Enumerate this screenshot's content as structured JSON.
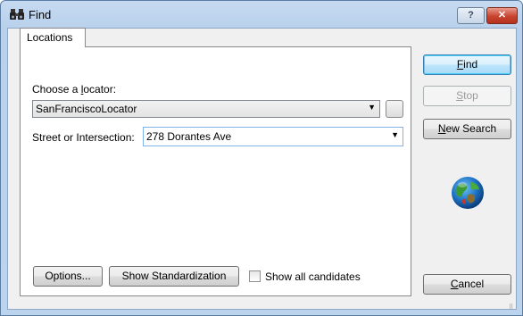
{
  "window": {
    "title": "Find",
    "help_glyph": "?",
    "close_glyph": "✕"
  },
  "tabs": [
    {
      "label": "Locations",
      "selected": true
    }
  ],
  "locator": {
    "label_pre": "Choose a ",
    "label_accel": "l",
    "label_post": "ocator:",
    "selected_value": "SanFranciscoLocator"
  },
  "street": {
    "label": "Street or Intersection:",
    "value": "278 Dorantes Ave"
  },
  "bottom": {
    "options_label": "Options...",
    "standardization_label": "Show Standardization",
    "show_all_label": "Show all candidates",
    "show_all_checked": false
  },
  "side_buttons": {
    "find_accel": "F",
    "find_rest": "ind",
    "stop_accel": "S",
    "stop_rest": "top",
    "new_search_accel": "N",
    "new_search_rest": "ew Search",
    "cancel_accel": "C",
    "cancel_rest": "ancel"
  },
  "icons": {
    "title": "binoculars-icon",
    "globe": "globe-icon",
    "dropdown": "chevron-down-icon"
  }
}
